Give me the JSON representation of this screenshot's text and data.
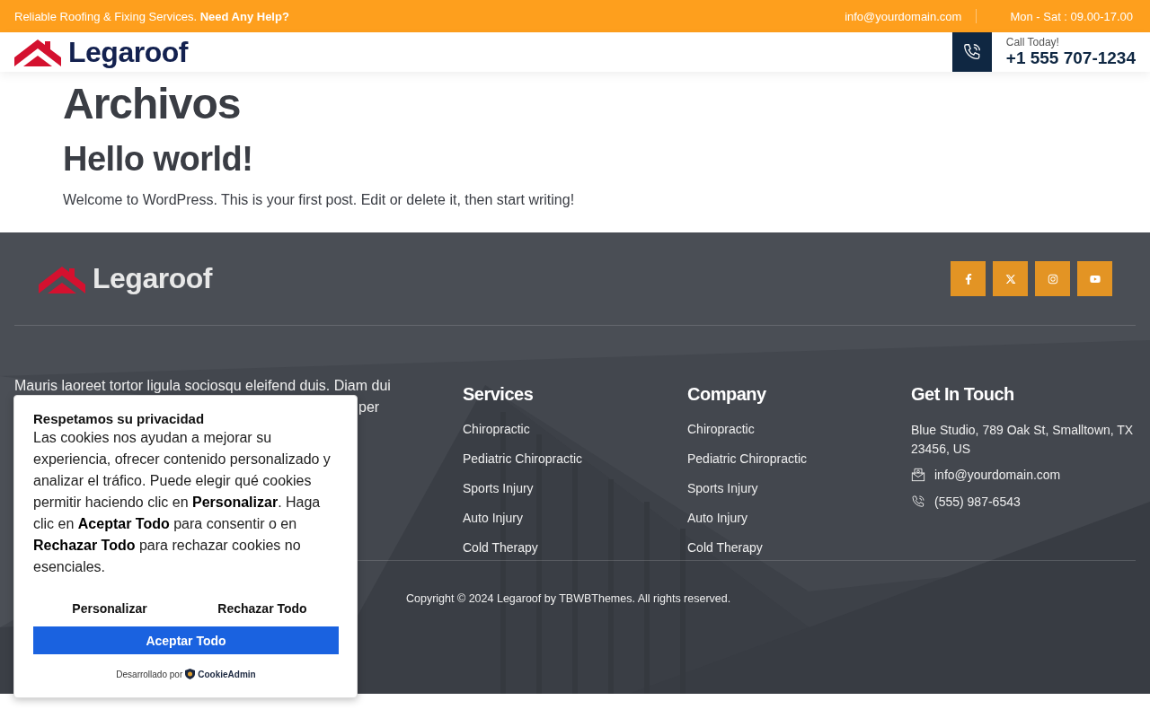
{
  "top_bar": {
    "tagline": "Reliable Roofing & Fixing Services. **Need Any Help?**",
    "email": "info@yourdomain.com",
    "hours": "Mon - Sat : 09.00-17.00"
  },
  "header": {
    "logo": "Legaroof",
    "call_label": "Call Today!",
    "call_number": "+1 555 707-1234"
  },
  "main": {
    "title": "Archivos",
    "post_title": "Hello world!",
    "post_excerpt": "Welcome to WordPress. This is your first post. Edit or delete it, then start writing!"
  },
  "footer": {
    "logo": "Legaroof",
    "socials": [
      {
        "kind": "facebook"
      },
      {
        "kind": "x"
      },
      {
        "kind": "instagram"
      },
      {
        "kind": "youtube"
      }
    ],
    "about_lines": [
      "Mauris laoreet tortor ligula sociosqu eleifend duis. Diam dui",
      "per"
    ],
    "columns": [
      {
        "heading": "Services",
        "links": [
          "Chiropractic",
          "Pediatric Chiropractic",
          "Sports Injury",
          "Auto Injury",
          "Cold Therapy"
        ]
      },
      {
        "heading": "Company",
        "links": [
          "Chiropractic",
          "Pediatric Chiropractic",
          "Sports Injury",
          "Auto Injury",
          "Cold Therapy"
        ]
      }
    ],
    "contact": {
      "heading": "Get In Touch",
      "address": "Blue Studio, 789 Oak St, Smalltown, TX 23456, US",
      "email": "info@yourdomain.com",
      "phone": "(555) 987-6543"
    },
    "copyright": "Copyright © 2024 Legaroof by TBWBThemes. All rights reserved."
  },
  "cookie_banner": {
    "title": "Respetamos su privacidad",
    "body": "Las cookies nos ayudan a mejorar su experiencia, ofrecer contenido personalizado y analizar el tráfico. Puede elegir qué cookies permitir haciendo clic en **Personalizar**. Haga clic en **Aceptar Todo** para consentir o en **Rechazar Todo** para rechazar cookies no esenciales.",
    "customize": "Personalizar",
    "reject": "Rechazar Todo",
    "accept": "Aceptar Todo",
    "powered_by": "Desarrollado por",
    "brand": "CookieAdmin"
  }
}
